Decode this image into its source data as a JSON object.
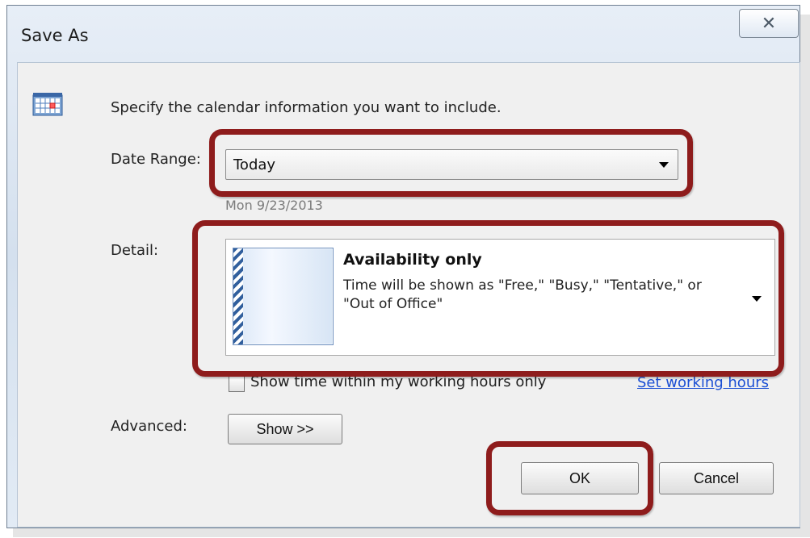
{
  "window": {
    "title": "Save As",
    "close_symbol": "✕"
  },
  "dialog": {
    "icon": "calendar-icon",
    "instruction": "Specify the calendar information you want to include.",
    "date_range": {
      "label": "Date Range:",
      "selected_value": "Today",
      "date_text": "Mon 9/23/2013"
    },
    "detail": {
      "label": "Detail:",
      "title": "Availability only",
      "description": "Time will be shown as \"Free,\" \"Busy,\" \"Tentative,\" or \"Out of Office\""
    },
    "working_hours": {
      "checkbox_label": "Show time within my working hours only",
      "checked": false,
      "link_text": "Set working hours"
    },
    "advanced": {
      "label": "Advanced:",
      "button_label": "Show >>"
    },
    "buttons": {
      "ok": "OK",
      "cancel": "Cancel"
    }
  },
  "colors": {
    "highlight": "#8e1c1c",
    "link": "#1b4fd4"
  }
}
